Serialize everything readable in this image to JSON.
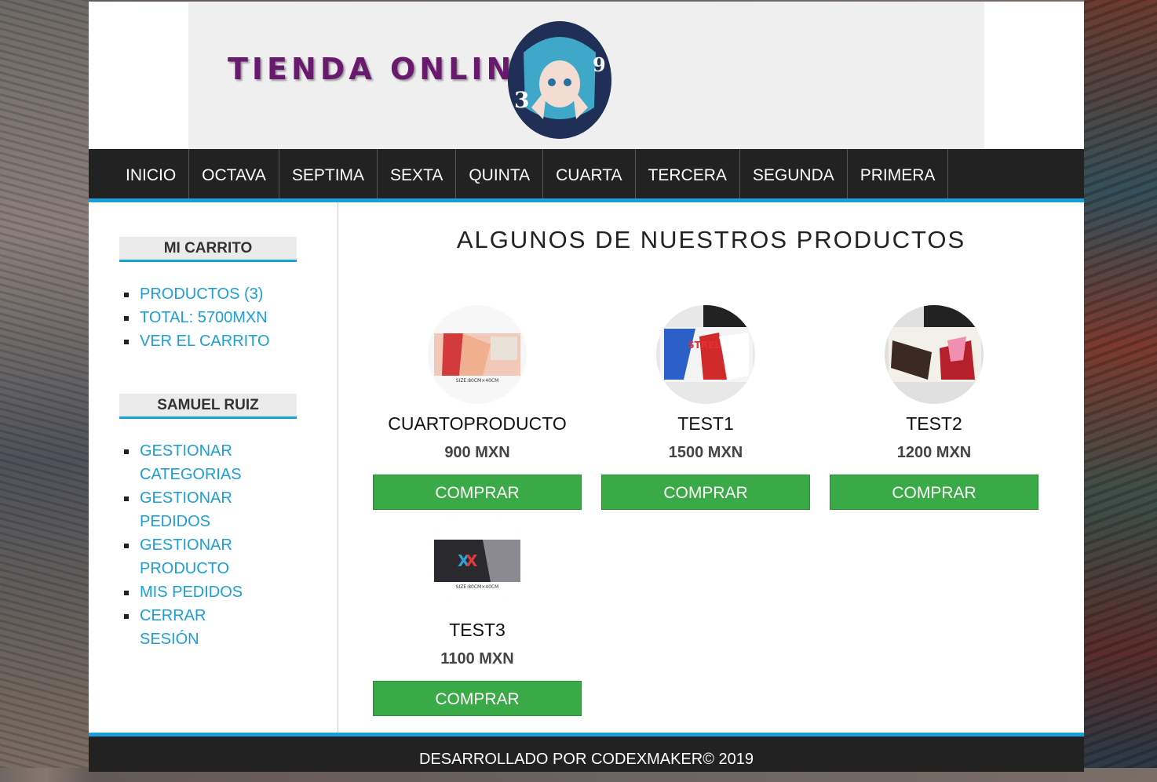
{
  "header": {
    "logo_text": "TIENDA ONLINE"
  },
  "nav": {
    "items": [
      "INICIO",
      "OCTAVA",
      "SEPTIMA",
      "SEXTA",
      "QUINTA",
      "CUARTA",
      "TERCERA",
      "SEGUNDA",
      "PRIMERA"
    ]
  },
  "sidebar": {
    "cart": {
      "title": "MI CARRITO",
      "items": [
        "PRODUCTOS (3)",
        "TOTAL: 5700MXN",
        "VER EL CARRITO"
      ]
    },
    "user": {
      "title": "SAMUEL RUIZ",
      "items": [
        "GESTIONAR CATEGORIAS",
        "GESTIONAR PEDIDOS",
        "GESTIONAR PRODUCTO",
        "MIS PEDIDOS",
        "CERRAR SESIÓN"
      ]
    }
  },
  "main": {
    "title": "ALGUNOS DE NUESTROS PRODUCTOS",
    "products": [
      {
        "name": "CUARTOPRODUCTO",
        "price": "900 MXN",
        "button": "COMPRAR"
      },
      {
        "name": "TEST1",
        "price": "1500 MXN",
        "button": "COMPRAR"
      },
      {
        "name": "TEST2",
        "price": "1200 MXN",
        "button": "COMPRAR"
      },
      {
        "name": "TEST3",
        "price": "1100 MXN",
        "button": "COMPRAR"
      }
    ]
  },
  "footer": {
    "text": "DESARROLLADO POR CODEXMAKER© 2019"
  },
  "colors": {
    "accent": "#1a9fd8",
    "nav_bg": "#222222",
    "buy_button": "#3aaa46",
    "logo_text": "#6a1a6e"
  }
}
